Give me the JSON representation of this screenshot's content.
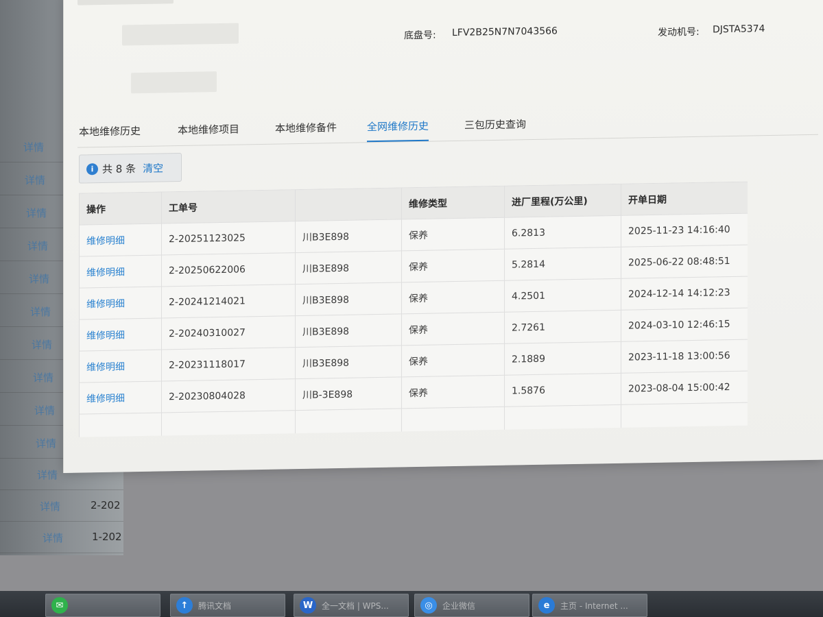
{
  "header": {
    "chassis_label": "底盘号:",
    "chassis_value": "LFV2B25N7N7043566",
    "engine_label": "发动机号:",
    "engine_value": "DJSTA5374"
  },
  "tabs": [
    {
      "label": "本地维修历史"
    },
    {
      "label": "本地维修项目"
    },
    {
      "label": "本地维修备件"
    },
    {
      "label": "全网维修历史"
    },
    {
      "label": "三包历史查询"
    }
  ],
  "summary": {
    "count_text": "共 8 条",
    "clear_label": "清空"
  },
  "table": {
    "headers": [
      "操作",
      "工单号",
      "",
      "维修类型",
      "进厂里程(万公里)",
      "开单日期"
    ],
    "rows": [
      [
        "维修明细",
        "2-20251123025",
        "川B3E898",
        "保养",
        "6.2813",
        "2025-11-23 14:16:40"
      ],
      [
        "维修明细",
        "2-20250622006",
        "川B3E898",
        "保养",
        "5.2814",
        "2025-06-22 08:48:51"
      ],
      [
        "维修明细",
        "2-20241214021",
        "川B3E898",
        "保养",
        "4.2501",
        "2024-12-14 14:12:23"
      ],
      [
        "维修明细",
        "2-20240310027",
        "川B3E898",
        "保养",
        "2.7261",
        "2024-03-10 12:46:15"
      ],
      [
        "维修明细",
        "2-20231118017",
        "川B3E898",
        "保养",
        "2.1889",
        "2023-11-18 13:00:56"
      ],
      [
        "维修明细",
        "2-20230804028",
        "川B-3E898",
        "保养",
        "1.5876",
        "2023-08-04 15:00:42"
      ]
    ]
  },
  "background_list": {
    "detail_label": "详情",
    "numbers": [
      "2-202",
      "1-202"
    ]
  },
  "taskbar": [
    {
      "label": "",
      "icon": "wechat-icon",
      "color": "#2fb24c"
    },
    {
      "label": "腾讯文档",
      "icon": "tencent-docs-icon",
      "color": "#2d7ed8"
    },
    {
      "label": "全一文档 | WPS...",
      "icon": "wps-icon",
      "color": "#2a66c8"
    },
    {
      "label": "企业微信",
      "icon": "wecom-icon",
      "color": "#3a8ee6"
    },
    {
      "label": "主页 - Internet ...",
      "icon": "ie-icon",
      "color": "#2b7bd6"
    }
  ],
  "colors": {
    "accent": "#1f78c8",
    "link": "#2a82d0"
  }
}
